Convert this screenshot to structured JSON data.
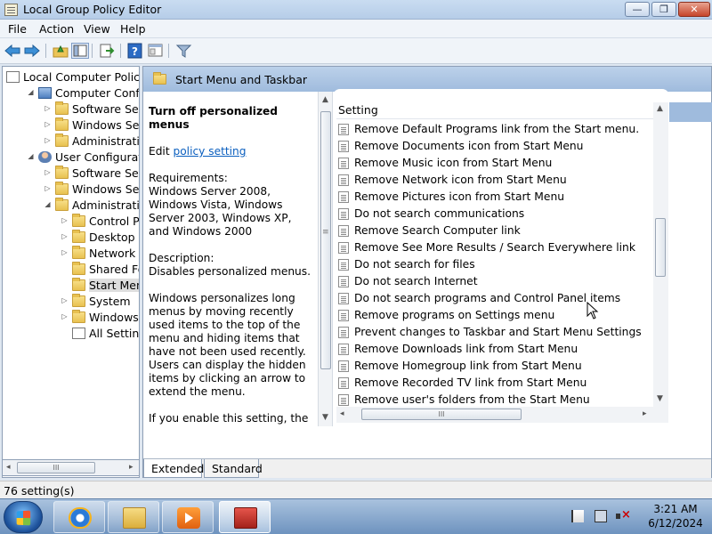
{
  "window": {
    "title": "Local Group Policy Editor",
    "buttons": {
      "minimize": "—",
      "maximize": "❐",
      "close": "✕"
    }
  },
  "menu": [
    "File",
    "Action",
    "View",
    "Help"
  ],
  "toolbar": [
    "back-arrow-icon",
    "forward-arrow-icon",
    "up-folder-icon",
    "show-hide-tree-icon",
    "export-list-icon",
    "help-icon",
    "properties-icon",
    "filter-icon"
  ],
  "tree": [
    {
      "label": "Local Computer Policy",
      "expander": "",
      "icon": "doc"
    },
    {
      "label": "Computer Configura",
      "expander": "◢",
      "icon": "pc"
    },
    {
      "label": "Software Settings",
      "expander": "▷",
      "icon": "folder"
    },
    {
      "label": "Windows Setting",
      "expander": "▷",
      "icon": "folder"
    },
    {
      "label": "Administrative Te",
      "expander": "▷",
      "icon": "folder"
    },
    {
      "label": "User Configuration",
      "expander": "◢",
      "icon": "user"
    },
    {
      "label": "Software Settings",
      "expander": "▷",
      "icon": "folder"
    },
    {
      "label": "Windows Setting",
      "expander": "▷",
      "icon": "folder"
    },
    {
      "label": "Administrative Te",
      "expander": "◢",
      "icon": "folder"
    },
    {
      "label": "Control Panel",
      "expander": "▷",
      "icon": "folder"
    },
    {
      "label": "Desktop",
      "expander": "▷",
      "icon": "folder"
    },
    {
      "label": "Network",
      "expander": "▷",
      "icon": "folder"
    },
    {
      "label": "Shared Folder",
      "expander": "",
      "icon": "folder"
    },
    {
      "label": "Start Menu ar",
      "expander": "",
      "icon": "folder",
      "selected": true
    },
    {
      "label": "System",
      "expander": "▷",
      "icon": "folder"
    },
    {
      "label": "Windows Cor",
      "expander": "▷",
      "icon": "folder"
    },
    {
      "label": "All Settings",
      "expander": "",
      "icon": "doc"
    }
  ],
  "tree_scroll": {
    "left": "◂",
    "grip": "III",
    "right": "▸"
  },
  "details": {
    "header": "Start Menu and Taskbar",
    "description": {
      "title": "Turn off personalized menus",
      "edit_prefix": "Edit ",
      "edit_link": "policy setting",
      "requirements_label": "Requirements:",
      "requirements_text": "Windows Server 2008, Windows Vista, Windows Server 2003, Windows XP, and Windows 2000",
      "description_label": "Description:",
      "description_text": "Disables personalized menus.",
      "para1": "Windows personalizes long menus by moving recently used items to the top of the menu and hiding items that have not been used recently. Users can display the hidden items by clicking an arrow to extend the menu.",
      "para2": "If you enable this setting, the system does not personalize menus. All menu items appear and remain in standard order."
    },
    "column_header": "Setting",
    "settings": [
      "Remove Default Programs link from the Start menu.",
      "Remove Documents icon from Start Menu",
      "Remove Music icon from Start Menu",
      "Remove Network icon from Start Menu",
      "Remove Pictures icon from Start Menu",
      "Do not search communications",
      "Remove Search Computer link",
      "Remove See More Results / Search Everywhere link",
      "Do not search for files",
      "Do not search Internet",
      "Do not search programs and Control Panel items",
      "Remove programs on Settings menu",
      "Prevent changes to Taskbar and Start Menu Settings",
      "Remove Downloads link from Start Menu",
      "Remove Homegroup link from Start Menu",
      "Remove Recorded TV link from Start Menu",
      "Remove user's folders from the Start Menu"
    ],
    "tabs": [
      "Extended",
      "Standard"
    ]
  },
  "status": "76 setting(s)",
  "taskbar": {
    "apps": [
      "internet-explorer",
      "windows-explorer",
      "media-player",
      "group-policy-editor"
    ],
    "time": "3:21 AM",
    "date": "6/12/2024"
  },
  "colors": {
    "link": "#0b5fbf",
    "header_band": "#9fbbdd",
    "close_button": "#c6452a"
  }
}
